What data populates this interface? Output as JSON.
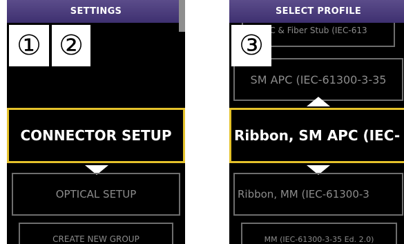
{
  "left": {
    "title": "SETTINGS",
    "selected": "CONNECTOR SETUP",
    "next": "OPTICAL SETUP",
    "next2": "CREATE NEW GROUP"
  },
  "right": {
    "title": "SELECT PROFILE",
    "top": "C & Fiber Stub (IEC-613",
    "prev": "SM APC (IEC-61300-3-35",
    "selected": "Ribbon, SM APC (IEC-",
    "next": "Ribbon, MM (IEC-61300-3",
    "next2": "MM (IEC-61300-3-35 Ed. 2.0)"
  },
  "callouts": [
    "①",
    "②",
    "③"
  ],
  "colors": {
    "title_bar": "#4c3d80",
    "selected_border": "#e5c22b",
    "item_border": "#6e6e6e"
  },
  "icons": {
    "scroll_up": "arrow-up-icon",
    "scroll_down": "arrow-down-icon"
  }
}
